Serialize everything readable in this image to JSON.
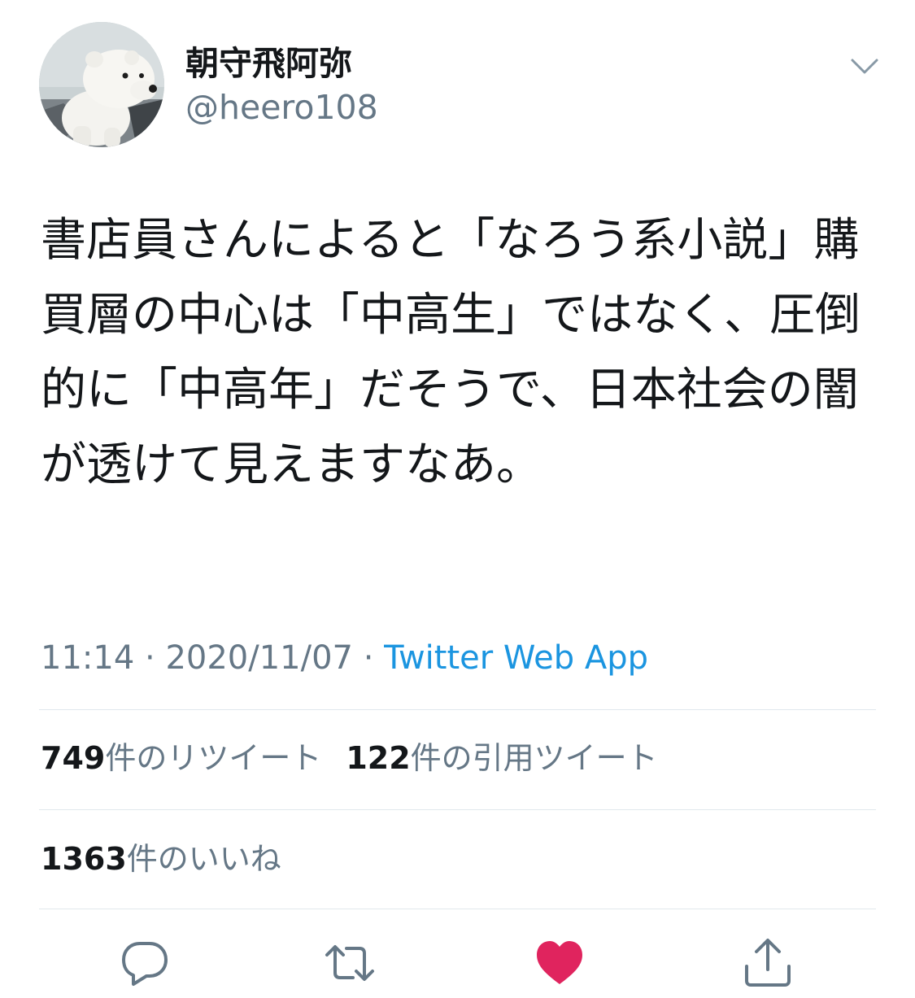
{
  "user": {
    "display_name": "朝守飛阿弥",
    "handle": "@heero108",
    "avatar_icon": "polar-bear-avatar"
  },
  "tweet": {
    "text": "書店員さんによると「なろう系小説」購買層の中心は「中高生」ではなく、圧倒的に「中高年」だそうで、日本社会の闇が透けて見えますなあ。",
    "time": "11:14",
    "separator": " · ",
    "date": "2020/11/07",
    "source": "Twitter Web App"
  },
  "stats": {
    "retweets_count": "749",
    "retweets_label": "件のリツイート",
    "quotes_count": "122",
    "quotes_label": "件の引用ツイート",
    "likes_count": "1363",
    "likes_label": "件のいいね"
  },
  "actions": [
    {
      "icon": "reply-icon"
    },
    {
      "icon": "retweet-icon"
    },
    {
      "icon": "like-icon",
      "liked": true
    },
    {
      "icon": "share-icon"
    }
  ],
  "colors": {
    "text": "#14171a",
    "secondary": "#657786",
    "link": "#1b95e0",
    "like": "#e0245e",
    "divider": "#e1e8ed"
  }
}
